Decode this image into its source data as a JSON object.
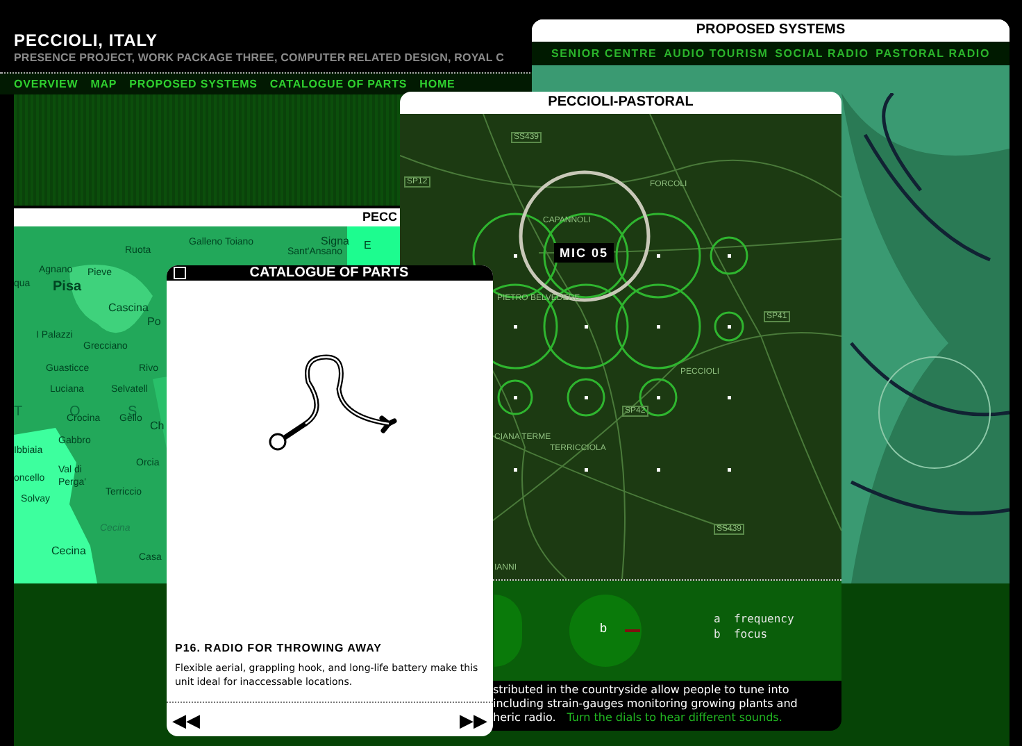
{
  "site": {
    "title": "PECCIOLI, ITALY",
    "subtitle": "PRESENCE PROJECT, WORK PACKAGE THREE, COMPUTER RELATED DESIGN, ROYAL C",
    "nav": [
      "OVERVIEW",
      "MAP",
      "PROPOSED SYSTEMS",
      "CATALOGUE OF PARTS",
      "HOME"
    ]
  },
  "area_map": {
    "title": "PECC",
    "labels": [
      {
        "text": "Ruota",
        "kind": "village"
      },
      {
        "text": "Galleno Toiano",
        "kind": "village"
      },
      {
        "text": "Signa",
        "kind": "town"
      },
      {
        "text": "E",
        "kind": "town"
      },
      {
        "text": "Sant'Ansano",
        "kind": "village"
      },
      {
        "text": "qua",
        "kind": "village"
      },
      {
        "text": "Agnano",
        "kind": "village"
      },
      {
        "text": "Pieve",
        "kind": "village"
      },
      {
        "text": "Pisa",
        "kind": "city"
      },
      {
        "text": "Cascina",
        "kind": "town"
      },
      {
        "text": "Po",
        "kind": "town"
      },
      {
        "text": "I Palazzi",
        "kind": "village"
      },
      {
        "text": "Grecciano",
        "kind": "village"
      },
      {
        "text": "Guasticce",
        "kind": "village"
      },
      {
        "text": "Rivo",
        "kind": "village"
      },
      {
        "text": "Luciana",
        "kind": "village"
      },
      {
        "text": "Selvatell",
        "kind": "village"
      },
      {
        "text": "T",
        "kind": "region"
      },
      {
        "text": "O",
        "kind": "region"
      },
      {
        "text": "S",
        "kind": "region"
      },
      {
        "text": "Crocina",
        "kind": "village"
      },
      {
        "text": "Gello",
        "kind": "village"
      },
      {
        "text": "Ch",
        "kind": "town"
      },
      {
        "text": "Gabbro",
        "kind": "village"
      },
      {
        "text": "Ibbiaia",
        "kind": "village"
      },
      {
        "text": "Orcia",
        "kind": "village"
      },
      {
        "text": "Val di",
        "kind": "village"
      },
      {
        "text": "Perga'",
        "kind": "village"
      },
      {
        "text": "oncello",
        "kind": "village"
      },
      {
        "text": "Solvay",
        "kind": "village"
      },
      {
        "text": "Terriccio",
        "kind": "village"
      },
      {
        "text": "Cecina",
        "kind": "river"
      },
      {
        "text": "Cecina",
        "kind": "town"
      },
      {
        "text": "Casa",
        "kind": "village"
      }
    ]
  },
  "proposed": {
    "title": "PROPOSED SYSTEMS",
    "nav": [
      "SENIOR CENTRE",
      "AUDIO TOURISM",
      "SOCIAL RADIO",
      "PASTORAL RADIO"
    ]
  },
  "pastoral": {
    "title": "PECCIOLI-PASTORAL",
    "mic_label": "MIC 05",
    "labels": [
      {
        "text": "SS439",
        "kind": "road"
      },
      {
        "text": "SP12",
        "kind": "road"
      },
      {
        "text": "FORCOLI",
        "kind": "place"
      },
      {
        "text": "CAPANNOLI",
        "kind": "place"
      },
      {
        "text": "PIETRO BELVEDERE",
        "kind": "place"
      },
      {
        "text": "SP41",
        "kind": "road"
      },
      {
        "text": "PECCIOLI",
        "kind": "place"
      },
      {
        "text": "SP42",
        "kind": "road"
      },
      {
        "text": "CIANA TERME",
        "kind": "place"
      },
      {
        "text": "TERRICCIOLA",
        "kind": "place"
      },
      {
        "text": "SS439",
        "kind": "road"
      },
      {
        "text": "IANNI",
        "kind": "place"
      }
    ],
    "dial_label": "b",
    "legend": [
      "a  frequency",
      "b  focus"
    ],
    "description": [
      "stributed in the countryside allow people to tune into",
      "including strain-gauges monitoring growing plants and",
      "heric radio."
    ],
    "hint": "Turn the dials to hear different sounds."
  },
  "catalogue": {
    "title": "CATALOGUE OF PARTS",
    "part_title": "P16. RADIO FOR THROWING AWAY",
    "part_text": "Flexible aerial, grappling hook, and long-life battery make this unit ideal for inaccessable locations.",
    "prev": "◀◀",
    "next": "▶▶"
  }
}
